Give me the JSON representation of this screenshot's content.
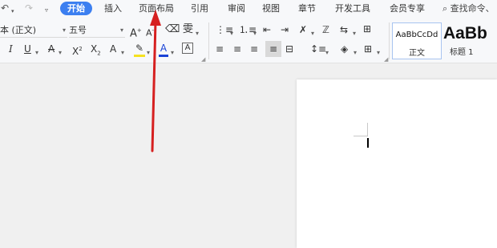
{
  "menubar": {
    "undo_icon": "undo-icon",
    "redo_icon": "redo-icon",
    "quick_access_icon": "dropdown-icon",
    "tabs": [
      {
        "label": "开始",
        "active": true
      },
      {
        "label": "插入"
      },
      {
        "label": "页面布局"
      },
      {
        "label": "引用"
      },
      {
        "label": "审阅"
      },
      {
        "label": "视图"
      },
      {
        "label": "章节"
      },
      {
        "label": "开发工具"
      },
      {
        "label": "会员专享"
      }
    ],
    "search_placeholder": "查找命令、"
  },
  "ribbon": {
    "font_name": "本 (正文)",
    "font_size": "五号",
    "bold_glyph": "A",
    "styles": {
      "normal_sample": "AaBbCcDd",
      "normal_name": "正文",
      "heading_sample": "AaBb",
      "heading_name": "标题 1"
    },
    "colors": {
      "accent": "#3c7ff0",
      "highlight": "#f5e120",
      "font_color": "#1a43d6"
    }
  },
  "annotation": {
    "arrow_color": "#d62020",
    "points_to": "页面布局"
  }
}
